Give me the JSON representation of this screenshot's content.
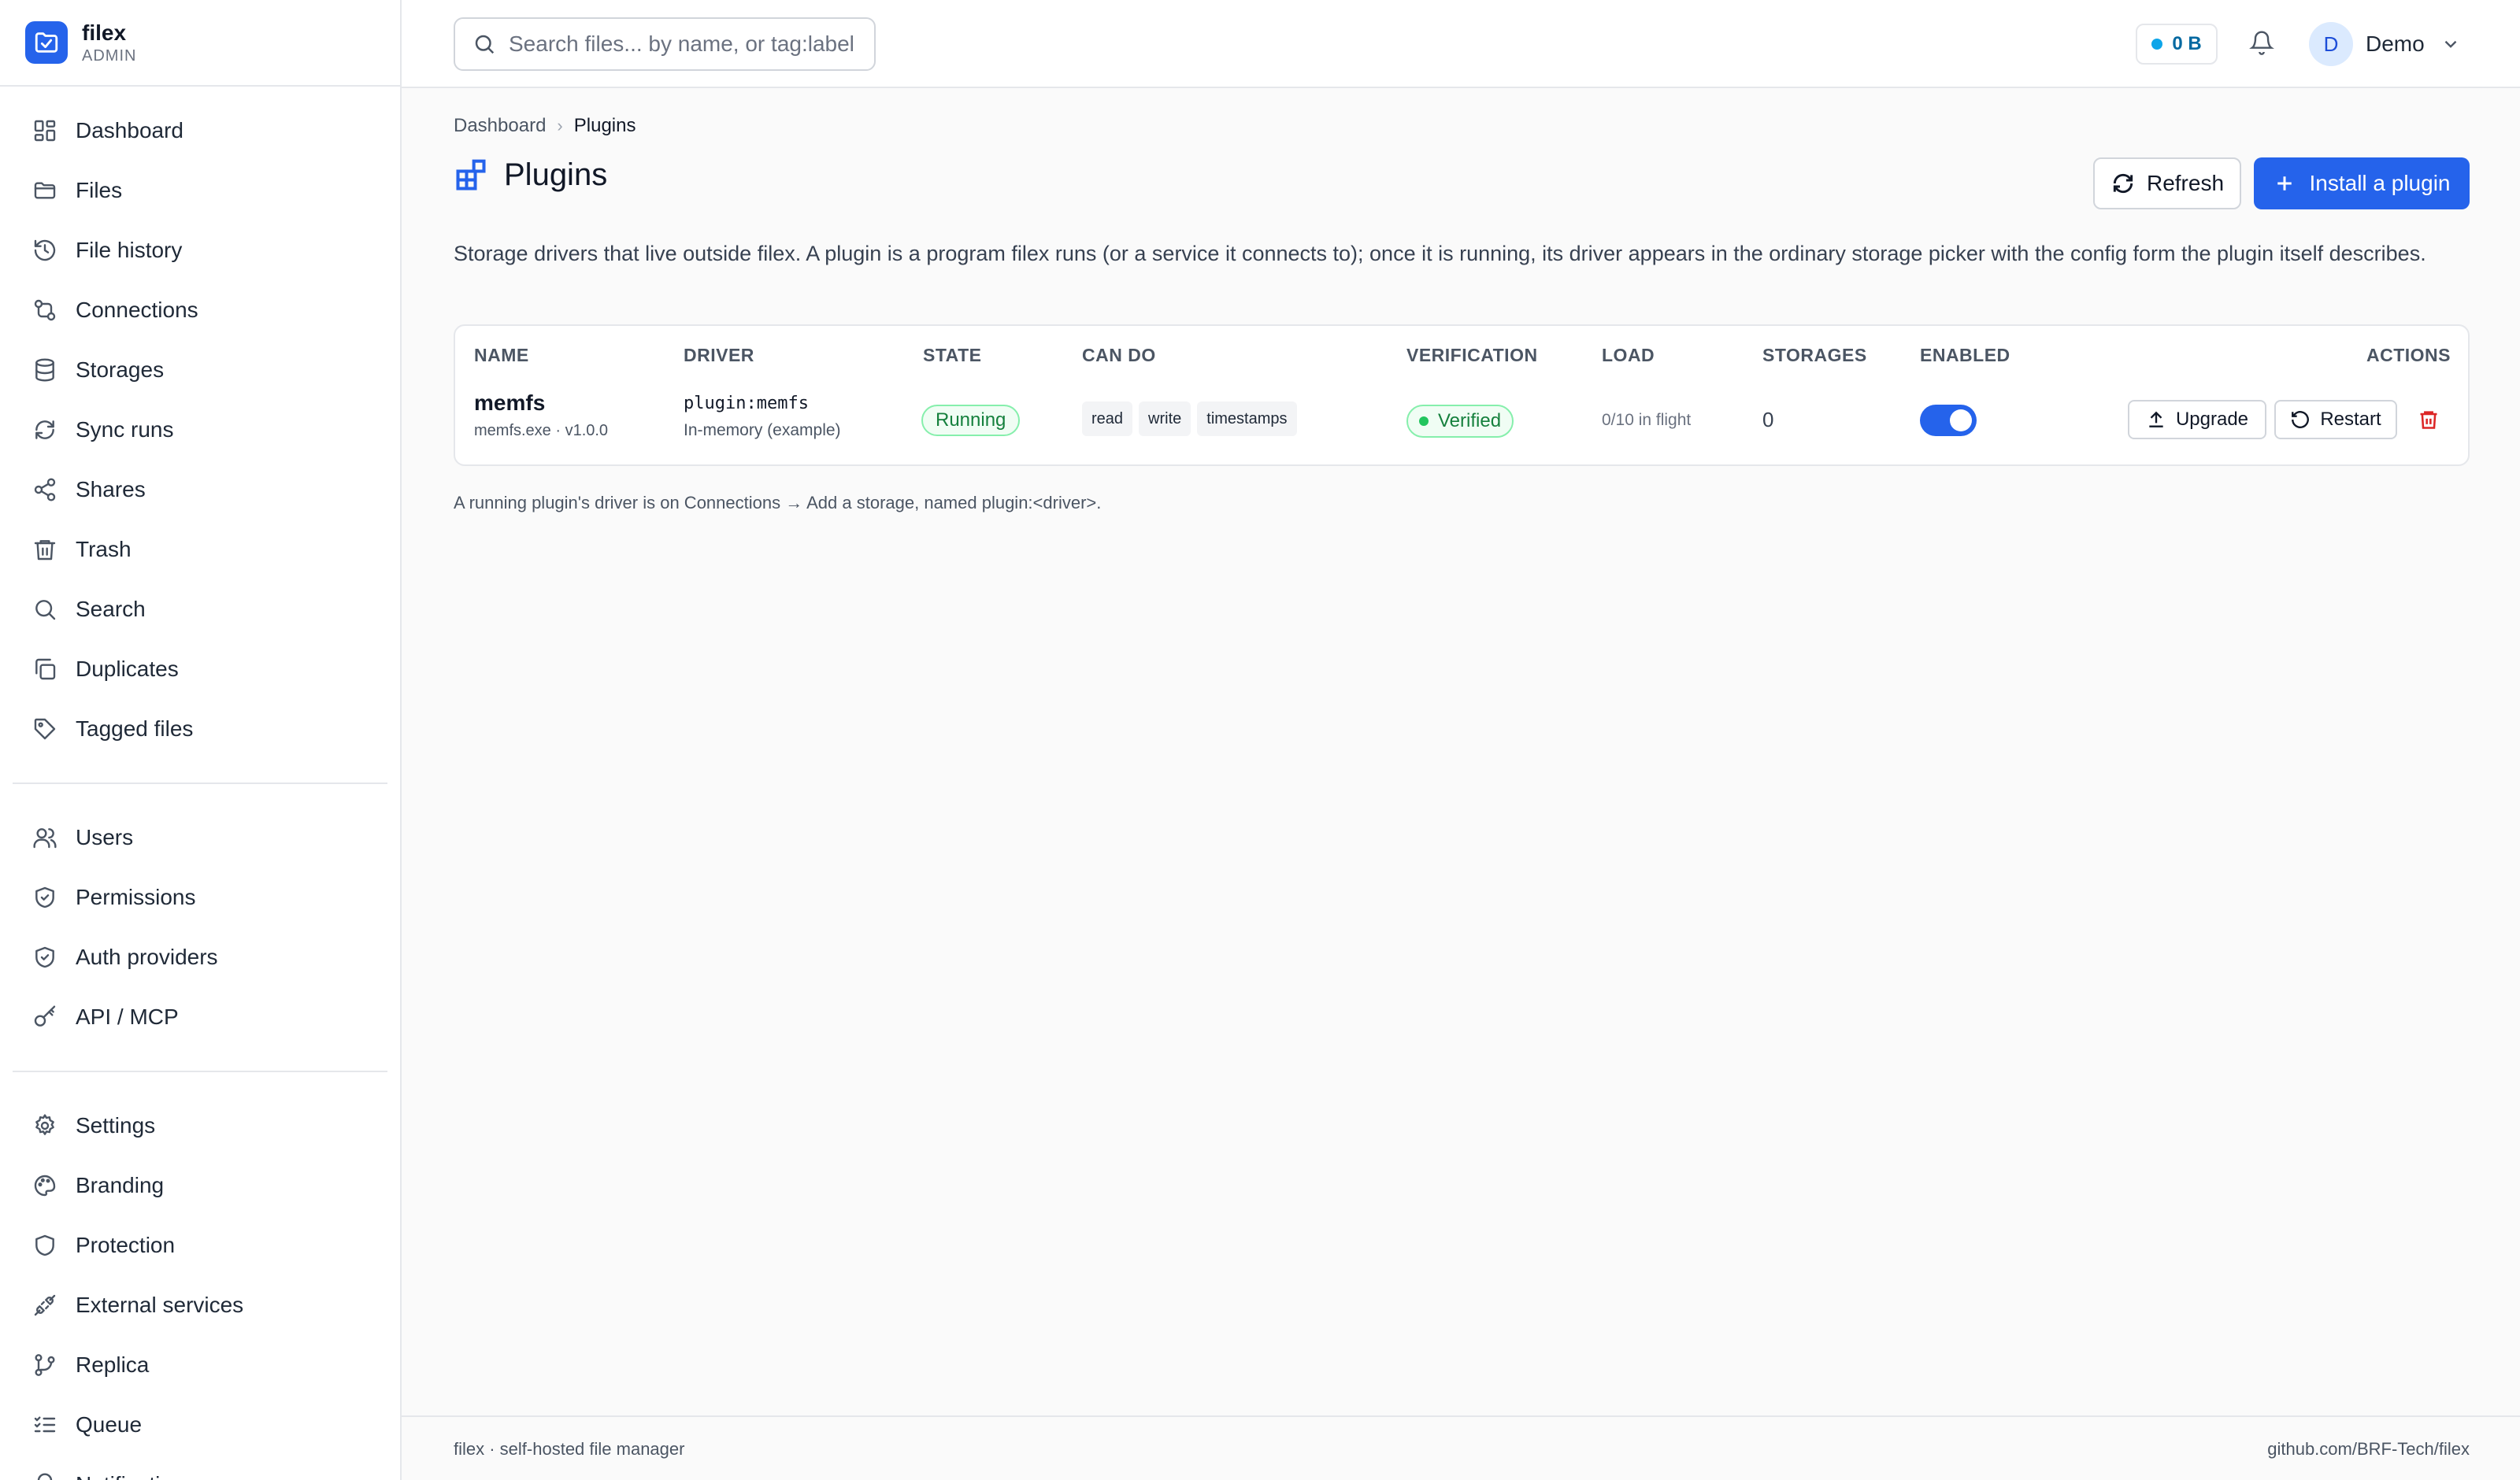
{
  "app": {
    "name": "filex",
    "role": "ADMIN"
  },
  "sidebar": {
    "items": [
      {
        "label": "Dashboard",
        "icon": "dashboard-icon"
      },
      {
        "label": "Files",
        "icon": "folder-icon"
      },
      {
        "label": "File history",
        "icon": "history-icon"
      },
      {
        "label": "Connections",
        "icon": "connections-icon"
      },
      {
        "label": "Storages",
        "icon": "database-icon"
      },
      {
        "label": "Sync runs",
        "icon": "sync-icon"
      },
      {
        "label": "Shares",
        "icon": "share-icon"
      },
      {
        "label": "Trash",
        "icon": "trash-icon"
      },
      {
        "label": "Search",
        "icon": "search-icon"
      },
      {
        "label": "Duplicates",
        "icon": "copy-icon"
      },
      {
        "label": "Tagged files",
        "icon": "tag-icon"
      }
    ],
    "admin_items": [
      {
        "label": "Users",
        "icon": "users-icon"
      },
      {
        "label": "Permissions",
        "icon": "shield-check-icon"
      },
      {
        "label": "Auth providers",
        "icon": "shield-check-icon"
      },
      {
        "label": "API / MCP",
        "icon": "key-icon"
      }
    ],
    "system_items": [
      {
        "label": "Settings",
        "icon": "gear-icon"
      },
      {
        "label": "Branding",
        "icon": "palette-icon"
      },
      {
        "label": "Protection",
        "icon": "shield-icon"
      },
      {
        "label": "External services",
        "icon": "plug-icon"
      },
      {
        "label": "Replica",
        "icon": "git-branch-icon"
      },
      {
        "label": "Queue",
        "icon": "list-checks-icon"
      },
      {
        "label": "Notifications",
        "icon": "bell-icon"
      }
    ]
  },
  "topbar": {
    "search_placeholder": "Search files... by name, or tag:label",
    "storage_usage": "0 B",
    "user_initial": "D",
    "user_name": "Demo"
  },
  "breadcrumb": {
    "parent": "Dashboard",
    "current": "Plugins"
  },
  "page": {
    "title": "Plugins",
    "refresh_label": "Refresh",
    "install_label": "Install a plugin",
    "description": "Storage drivers that live outside filex. A plugin is a program filex runs (or a service it connects to); once it is running, its driver appears in the ordinary storage picker with the config form the plugin itself describes.",
    "note": "A running plugin's driver is on Connections → Add a storage, named plugin:<driver>."
  },
  "table": {
    "headers": [
      "NAME",
      "DRIVER",
      "STATE",
      "CAN DO",
      "VERIFICATION",
      "LOAD",
      "STORAGES",
      "ENABLED",
      "ACTIONS"
    ],
    "rows": [
      {
        "name": "memfs",
        "name_sub": "memfs.exe · v1.0.0",
        "driver": "plugin:memfs",
        "driver_sub": "In-memory (example)",
        "state": "Running",
        "capabilities": [
          "read",
          "write",
          "timestamps"
        ],
        "verification": "Verified",
        "load": "0/10 in flight",
        "storages": "0",
        "enabled": true,
        "upgrade_label": "Upgrade",
        "restart_label": "Restart"
      }
    ]
  },
  "footer": {
    "left": "filex · self-hosted file manager",
    "right": "github.com/BRF-Tech/filex"
  },
  "colors": {
    "accent": "#2563eb",
    "success": "#15803d",
    "danger": "#dc2626"
  }
}
